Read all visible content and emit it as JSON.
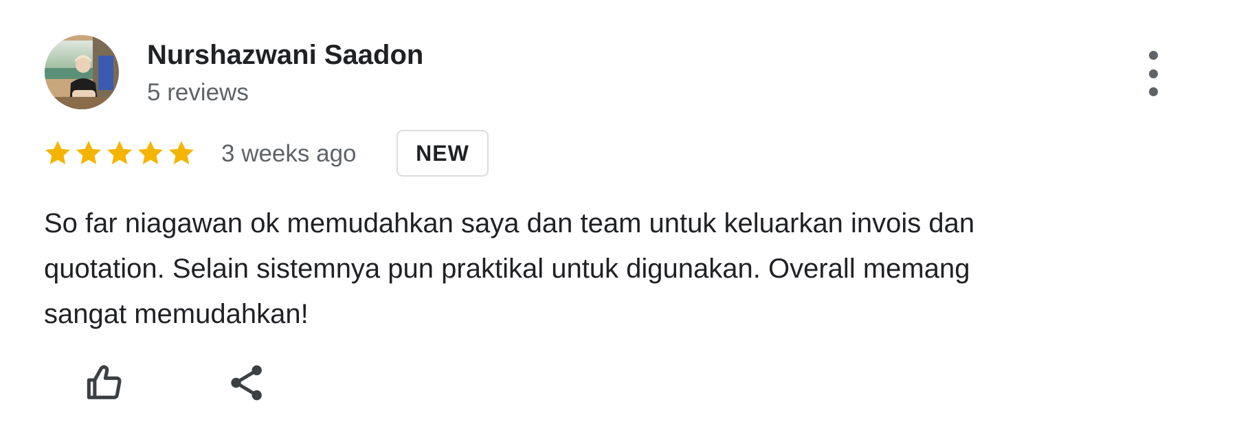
{
  "reviewer": {
    "name": "Nurshazwani Saadon",
    "review_count": "5 reviews",
    "avatar_icon": "profile-photo"
  },
  "rating": {
    "stars": 5,
    "max_stars": 5,
    "star_color": "#F4B400"
  },
  "meta": {
    "time_ago": "3 weeks ago",
    "badge": "NEW"
  },
  "review": {
    "lines": [
      "So far niagawan ok memudahkan saya dan team untuk keluarkan invois dan",
      "quotation. Selain sistemnya pun praktikal untuk digunakan. Overall memang",
      "sangat memudahkan!"
    ]
  },
  "actions": {
    "like_icon": "thumbs-up-icon",
    "share_icon": "share-icon",
    "more_icon": "more-vertical-icon"
  },
  "colors": {
    "text_primary": "#202124",
    "text_secondary": "#5f6368",
    "badge_border": "#dadce0"
  }
}
